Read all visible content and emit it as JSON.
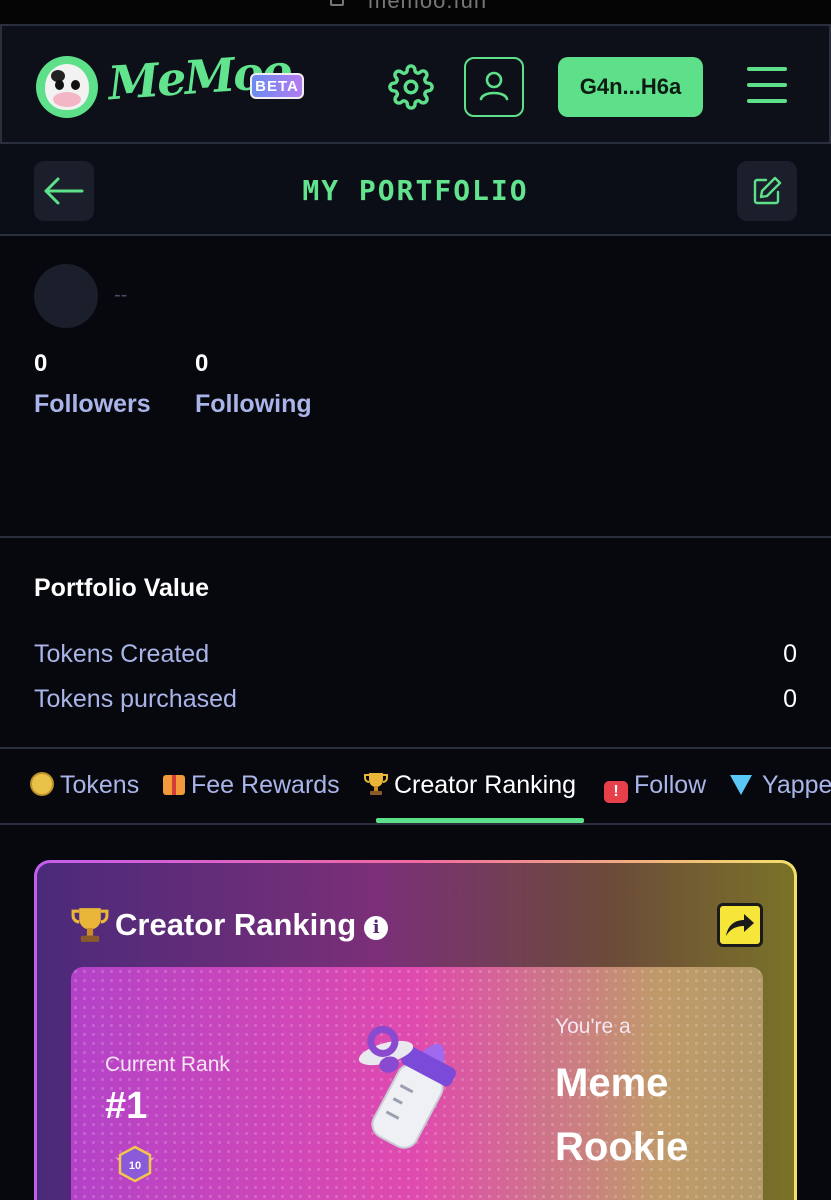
{
  "browser": {
    "url": "memoo.fun"
  },
  "header": {
    "brand": "MeMoo",
    "beta_label": "BETA",
    "wallet_label": "G4n...H6a",
    "icons": [
      "logo-cow",
      "gear-icon",
      "user-icon",
      "menu-icon"
    ],
    "accent_color": "#5ee08a"
  },
  "titlebar": {
    "title": "MY PORTFOLIO",
    "icons": [
      "back-arrow-icon",
      "edit-icon"
    ]
  },
  "profile": {
    "username": "--",
    "followers_count": "0",
    "followers_label": "Followers",
    "following_count": "0",
    "following_label": "Following"
  },
  "portfolio": {
    "title": "Portfolio Value",
    "rows": [
      {
        "label": "Tokens Created",
        "value": "0"
      },
      {
        "label": "Tokens purchased",
        "value": "0"
      }
    ]
  },
  "tabs": {
    "items": [
      {
        "label": "Tokens",
        "icon": "coin-icon"
      },
      {
        "label": "Fee Rewards",
        "icon": "gift-icon"
      },
      {
        "label": "Creator Ranking",
        "icon": "trophy-icon",
        "active": true
      },
      {
        "label": "Follow",
        "icon": "alert-icon"
      },
      {
        "label": "Yappe",
        "icon": "gem-icon"
      }
    ]
  },
  "ranking_card": {
    "title": "Creator Ranking",
    "current_rank_label": "Current Rank",
    "current_rank_value": "#1",
    "level": "10",
    "youre_label": "You're a",
    "rank_name_line1": "Meme",
    "rank_name_line2": "Rookie"
  }
}
